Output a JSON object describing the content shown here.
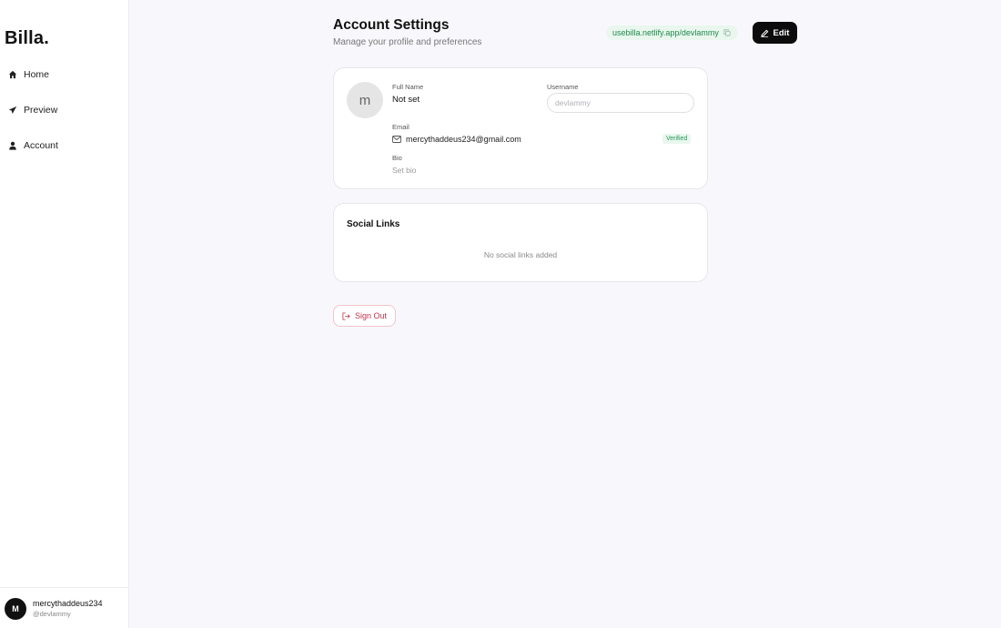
{
  "sidebar": {
    "logo": "Billa.",
    "items": [
      {
        "label": "Home",
        "icon": "home-icon"
      },
      {
        "label": "Preview",
        "icon": "send-icon"
      },
      {
        "label": "Account",
        "icon": "user-icon"
      }
    ],
    "user": {
      "initial": "M",
      "name": "mercythaddeus234",
      "handle": "@devlammy"
    }
  },
  "header": {
    "title": "Account Settings",
    "subtitle": "Manage your profile and preferences",
    "profile_url": "usebilla.netlify.app/devlammy",
    "edit_label": "Edit"
  },
  "profile": {
    "avatar_initial": "m",
    "full_name_label": "Full Name",
    "full_name_value": "Not set",
    "username_label": "Username",
    "username_placeholder": "devlammy",
    "email_label": "Email",
    "email_value": "mercythaddeus234@gmail.com",
    "verified_label": "Verified",
    "bio_label": "Bio",
    "bio_value": "Set bio"
  },
  "social": {
    "title": "Social Links",
    "empty_text": "No social links added"
  },
  "signout_label": "Sign Out",
  "colors": {
    "accent": "#0c0c0c",
    "success_bg": "#e9f7ee",
    "success_text": "#1f8a4c",
    "danger": "#c0344d"
  }
}
